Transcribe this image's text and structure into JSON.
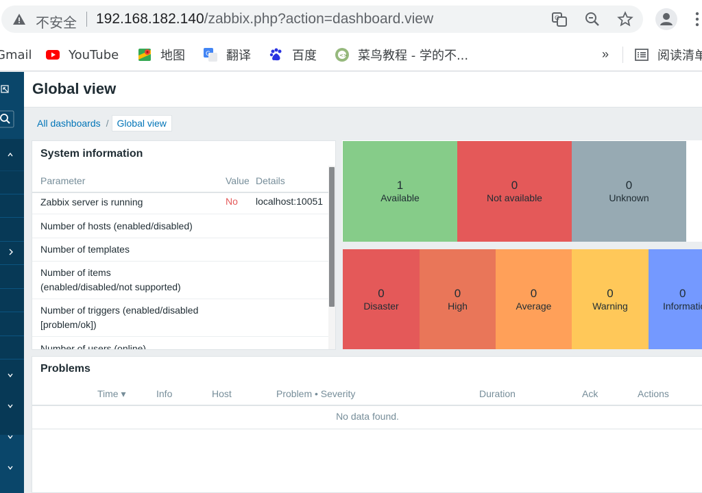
{
  "browser": {
    "security_label": "不安全",
    "url_host": "192.168.182.140",
    "url_path": "/zabbix.php?action=dashboard.view",
    "bookmarks": [
      {
        "label": "Gmail",
        "icon": "gmail-icon"
      },
      {
        "label": "YouTube",
        "icon": "youtube-icon"
      },
      {
        "label": "地图",
        "icon": "maps-icon"
      },
      {
        "label": "翻译",
        "icon": "translate-icon"
      },
      {
        "label": "百度",
        "icon": "baidu-icon"
      },
      {
        "label": "菜鸟教程 - 学的不...",
        "icon": "runoob-icon"
      }
    ],
    "more_label": "»",
    "reading_list_label": "阅读清单"
  },
  "page": {
    "title": "Global view",
    "breadcrumb": {
      "parent": "All dashboards",
      "separator": "/",
      "current": "Global view"
    }
  },
  "system_info": {
    "title": "System information",
    "columns": {
      "parameter": "Parameter",
      "value": "Value",
      "details": "Details"
    },
    "rows": [
      {
        "parameter": "Zabbix server is running",
        "value": "No",
        "details": "localhost:10051"
      },
      {
        "parameter": "Number of hosts (enabled/disabled)",
        "value": "",
        "details": ""
      },
      {
        "parameter": "Number of templates",
        "value": "",
        "details": ""
      },
      {
        "parameter": "Number of items (enabled/disabled/not supported)",
        "value": "",
        "details": ""
      },
      {
        "parameter": "Number of triggers (enabled/disabled [problem/ok])",
        "value": "",
        "details": ""
      },
      {
        "parameter": "Number of users (online)",
        "value": "",
        "details": ""
      }
    ]
  },
  "host_availability": [
    {
      "count": "1",
      "label": "Available",
      "color": "#86cc89"
    },
    {
      "count": "0",
      "label": "Not available",
      "color": "#e45959"
    },
    {
      "count": "0",
      "label": "Unknown",
      "color": "#97aab3"
    }
  ],
  "problems_by_severity": [
    {
      "count": "0",
      "label": "Disaster",
      "color": "#e45959"
    },
    {
      "count": "0",
      "label": "High",
      "color": "#e97659"
    },
    {
      "count": "0",
      "label": "Average",
      "color": "#ffa059"
    },
    {
      "count": "0",
      "label": "Warning",
      "color": "#ffc859"
    },
    {
      "count": "0",
      "label": "Information",
      "color": "#7499ff"
    }
  ],
  "problems": {
    "title": "Problems",
    "columns": {
      "time": "Time ▾",
      "info": "Info",
      "host": "Host",
      "problem": "Problem • Severity",
      "duration": "Duration",
      "ack": "Ack",
      "actions": "Actions"
    },
    "empty_message": "No data found."
  }
}
